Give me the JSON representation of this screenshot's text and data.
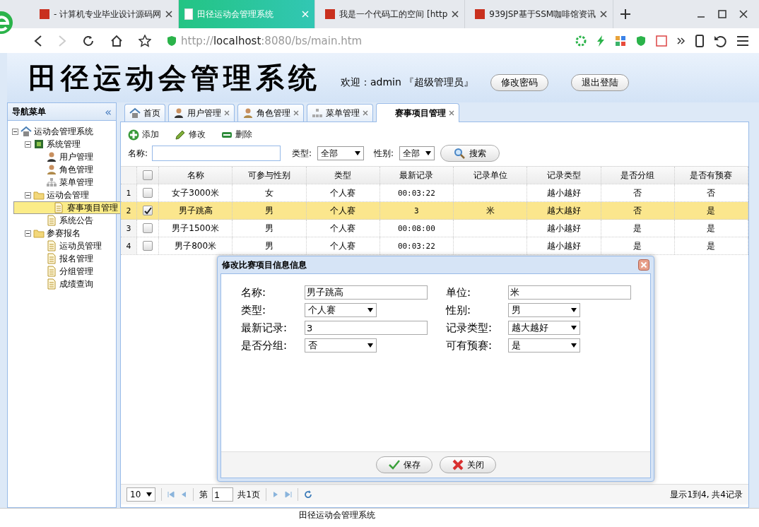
{
  "browser": {
    "tabs": [
      {
        "title": "- 计算机专业毕业设计源码网",
        "selected": false
      },
      {
        "title": "田径运动会管理系统",
        "selected": true
      },
      {
        "title": "我是一个代码工的空间 [http",
        "selected": false
      },
      {
        "title": "939JSP基于SSM咖啡馆资讯",
        "selected": false
      }
    ],
    "address": {
      "scheme": "http://",
      "host": "localhost",
      "rest": ":8080/bs/main.htm"
    }
  },
  "header": {
    "title": "田径运动会管理系统",
    "welcome": "欢迎：admin 『超级管理员』",
    "buttons": [
      "修改密码",
      "退出登陆"
    ]
  },
  "sidebar": {
    "title": "导航菜单",
    "collapse": "«",
    "tree": [
      {
        "label": "运动会管理系统",
        "kind": "home",
        "expanded": true,
        "selected": false,
        "children": [
          {
            "label": "系统管理",
            "kind": "system",
            "expanded": true,
            "selected": false,
            "children": [
              {
                "label": "用户管理",
                "kind": "user",
                "selected": false
              },
              {
                "label": "角色管理",
                "kind": "role",
                "selected": false
              },
              {
                "label": "菜单管理",
                "kind": "menu",
                "selected": false
              }
            ]
          },
          {
            "label": "运动会管理",
            "kind": "folder",
            "expanded": true,
            "selected": false,
            "children": [
              {
                "label": "赛事项目管理",
                "kind": "doc",
                "selected": true
              },
              {
                "label": "系统公告",
                "kind": "doc",
                "selected": false
              }
            ]
          },
          {
            "label": "参赛报名",
            "kind": "folder",
            "expanded": true,
            "selected": false,
            "children": [
              {
                "label": "运动员管理",
                "kind": "doc",
                "selected": false
              },
              {
                "label": "报名管理",
                "kind": "doc",
                "selected": false
              },
              {
                "label": "分组管理",
                "kind": "doc",
                "selected": false
              },
              {
                "label": "成绩查询",
                "kind": "doc",
                "selected": false
              }
            ]
          }
        ]
      }
    ]
  },
  "tabs": [
    {
      "label": "首页",
      "kind": "home",
      "closable": false,
      "selected": false
    },
    {
      "label": "用户管理",
      "kind": "user",
      "closable": true,
      "selected": false
    },
    {
      "label": "角色管理",
      "kind": "role",
      "closable": true,
      "selected": false
    },
    {
      "label": "菜单管理",
      "kind": "menu",
      "closable": true,
      "selected": false
    },
    {
      "label": "赛事项目管理",
      "kind": "none",
      "closable": true,
      "selected": true
    }
  ],
  "toolbar": [
    {
      "label": "添加",
      "kind": "add"
    },
    {
      "label": "修改",
      "kind": "edit"
    },
    {
      "label": "删除",
      "kind": "delete"
    }
  ],
  "filters": {
    "name_label": "名称:",
    "type_label": "类型:",
    "type_value": "全部",
    "gender_label": "性别:",
    "gender_value": "全部",
    "search": "搜索"
  },
  "table": {
    "columns": [
      "名称",
      "可参与性别",
      "类型",
      "最新记录",
      "记录单位",
      "记录类型",
      "是否分组",
      "是否有预赛"
    ],
    "select_all_checked": false,
    "rows": [
      {
        "num": "1",
        "checked": false,
        "selected": false,
        "cells": [
          "女子3000米",
          "女",
          "个人赛",
          "00:03:22",
          "",
          "越小越好",
          "否",
          "否"
        ]
      },
      {
        "num": "2",
        "checked": true,
        "selected": true,
        "cells": [
          "男子跳高",
          "男",
          "个人赛",
          "3",
          "米",
          "越大越好",
          "否",
          "是"
        ]
      },
      {
        "num": "3",
        "checked": false,
        "selected": false,
        "cells": [
          "男子1500米",
          "男",
          "个人赛",
          "00:08:00",
          "",
          "越小越好",
          "是",
          "是"
        ]
      },
      {
        "num": "4",
        "checked": false,
        "selected": false,
        "cells": [
          "男子800米",
          "男",
          "个人赛",
          "00:03:22",
          "",
          "越小越好",
          "是",
          "是"
        ]
      }
    ]
  },
  "dialog": {
    "title": "修改比赛项目信息信息",
    "fields": [
      {
        "label": "名称:",
        "value": "男子跳高",
        "kind": "text"
      },
      {
        "label": "单位:",
        "value": "米",
        "kind": "text"
      },
      {
        "label": "类型:",
        "value": "个人赛",
        "kind": "select"
      },
      {
        "label": "性别:",
        "value": "男",
        "kind": "select"
      },
      {
        "label": "最新记录:",
        "value": "3",
        "kind": "text"
      },
      {
        "label": "记录类型:",
        "value": "越大越好",
        "kind": "select"
      },
      {
        "label": "是否分组:",
        "value": "否",
        "kind": "select"
      },
      {
        "label": "可有预赛:",
        "value": "是",
        "kind": "select"
      }
    ],
    "buttons": [
      {
        "label": "保存",
        "kind": "save"
      },
      {
        "label": "关闭",
        "kind": "close"
      }
    ]
  },
  "pager": {
    "page_size": "10",
    "page_prefix": "第",
    "page": "1",
    "total": "共1页",
    "summary": "显示1到4, 共4记录"
  },
  "footer": "田径运动会管理系统"
}
